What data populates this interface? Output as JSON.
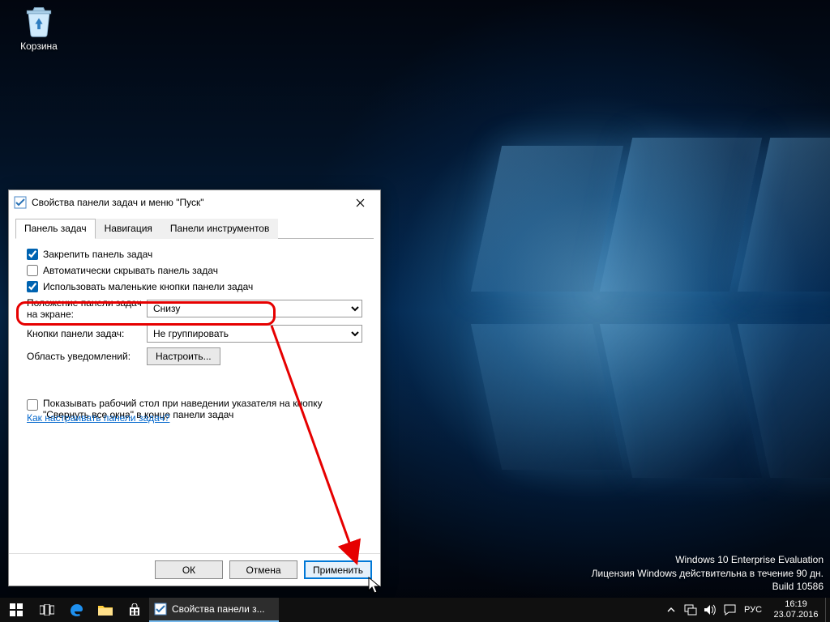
{
  "desktop": {
    "recycle_bin_label": "Корзина"
  },
  "watermark": {
    "line1": "Windows 10 Enterprise Evaluation",
    "line2": "Лицензия Windows действительна в течение 90 дн.",
    "line3": "Build 10586"
  },
  "dialog": {
    "title": "Свойства панели задач и меню \"Пуск\"",
    "tabs": {
      "taskbar": "Панель задач",
      "navigation": "Навигация",
      "toolbars": "Панели инструментов"
    },
    "checks": {
      "lock": "Закрепить панель задач",
      "autohide": "Автоматически скрывать панель задач",
      "small_icons": "Использовать маленькие кнопки панели задач",
      "peek": "Показывать рабочий стол при наведении указателя на кнопку \"Свернуть все окна\" в конце панели задач"
    },
    "fields": {
      "position_label": "Положение панели задач на экране:",
      "position_value": "Снизу",
      "buttons_label": "Кнопки панели задач:",
      "buttons_value": "Не группировать",
      "notify_label": "Область уведомлений:",
      "notify_button": "Настроить..."
    },
    "help_link": "Как настраивать панели задач?",
    "buttons": {
      "ok": "ОК",
      "cancel": "Отмена",
      "apply": "Применить"
    }
  },
  "taskbar": {
    "active_task": "Свойства панели з...",
    "lang": "РУС",
    "time": "16:19",
    "date": "23.07.2016"
  },
  "icons": {
    "recycle": "recycle-bin-icon",
    "close": "close-icon",
    "start": "start-icon",
    "taskview": "task-view-icon",
    "edge": "edge-icon",
    "explorer": "file-explorer-icon",
    "store": "store-icon",
    "tray_up": "tray-chevron-icon",
    "network": "network-icon",
    "volume": "volume-icon",
    "actioncenter": "action-center-icon"
  }
}
